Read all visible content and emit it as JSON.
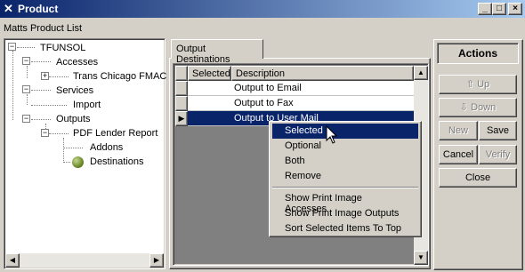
{
  "window": {
    "title": "Product",
    "caption": "Matts Product List",
    "minimize_glyph": "_",
    "maximize_glyph": "□",
    "close_glyph": "×"
  },
  "tree": {
    "root": "TFUNSOL",
    "nodes": [
      {
        "label": "Accesses"
      },
      {
        "label": "Trans Chicago FMAC"
      },
      {
        "label": "Services"
      },
      {
        "label": "Import"
      },
      {
        "label": "Outputs"
      },
      {
        "label": "PDF Lender Report"
      },
      {
        "label": "Addons"
      },
      {
        "label": "Destinations"
      }
    ]
  },
  "tabs": {
    "output_destinations": "Output Destinations"
  },
  "grid": {
    "columns": [
      "Selected",
      "Description"
    ],
    "rows": [
      {
        "selected": "",
        "description": "Output to Email"
      },
      {
        "selected": "",
        "description": "Output to Fax"
      },
      {
        "selected": "",
        "description": "Output to User Mail"
      }
    ],
    "current_row_marker": "▶"
  },
  "context_menu": {
    "items": [
      "Selected",
      "Optional",
      "Both",
      "Remove"
    ],
    "items2": [
      "Show Print Image Accesses",
      "Show Print Image Outputs",
      "Sort Selected Items To Top"
    ]
  },
  "actions": {
    "title": "Actions",
    "up": "Up",
    "down": "Down",
    "new": "New",
    "save": "Save",
    "cancel": "Cancel",
    "verify": "Verify",
    "close": "Close"
  },
  "colors": {
    "title_bar": "#0a246a",
    "selection": "#0a246a",
    "face": "#d4d0c8"
  }
}
